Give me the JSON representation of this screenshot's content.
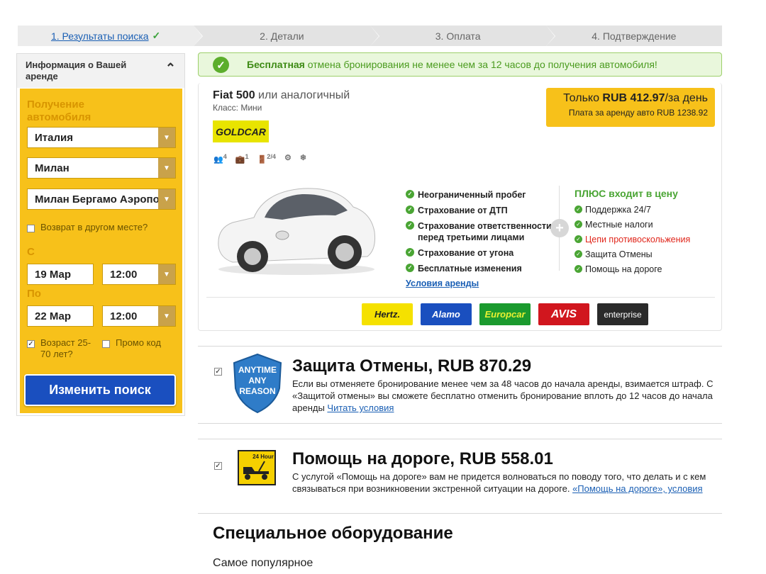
{
  "steps": [
    {
      "label": "1. Результаты поиска"
    },
    {
      "label": "2. Детали"
    },
    {
      "label": "3. Оплата"
    },
    {
      "label": "4. Подтверждение"
    }
  ],
  "sidebar": {
    "header": "Информация о Вашей аренде",
    "pickup_label": "Получение автомобиля",
    "country": "Италия",
    "city": "Милан",
    "location": "Милан Бергамо Аэропорт",
    "return_other": "Возврат в другом месте?",
    "from_label": "С",
    "from_date": "19 Мар",
    "from_time": "12:00",
    "to_label": "По",
    "to_date": "22 Мар",
    "to_time": "12:00",
    "age_label": "Возраст 25-70 лет?",
    "promo_label": "Промо код",
    "search_button": "Изменить поиск"
  },
  "banner": {
    "bold": "Бесплатная",
    "text": " отмена бронирования не менее чем за 12 часов до получения автомобиля!"
  },
  "car": {
    "name": "Fiat 500",
    "similar": " или аналогичный",
    "class": "Класс: Мини",
    "supplier_logo": "GOLDCAR",
    "seats": "4",
    "bags": "1",
    "doors": "2/4",
    "price_prefix": "Только ",
    "price_value": "RUB 412.97",
    "price_suffix": "/за день",
    "price_total": "Плата за аренду авто RUB 1238.92",
    "features": [
      "Неограниченный пробег",
      "Страхование от ДТП",
      "Страхование ответственности перед третьими лицами",
      "Страхование от угона",
      "Бесплатные изменения"
    ],
    "terms_link": "Условия аренды",
    "plus_title": "ПЛЮС входит в цену",
    "plus_items": [
      "Поддержка 24/7",
      "Местные налоги",
      "Цепи противоскольжения",
      "Защита Отмены",
      "Помощь на дороге"
    ],
    "brands": [
      "Hertz.",
      "Alamo",
      "Europcar",
      "AVIS",
      "enterprise"
    ]
  },
  "protection": {
    "badge": "ANYTIME ANY REASON",
    "title": "Защита Отмены, RUB 870.29",
    "text": "Если вы отменяете бронирование менее чем за 48 часов до начала аренды, взимается штраф. С «Защитой отмены» вы сможете бесплатно отменить бронирование вплоть до 12 часов до начала аренды ",
    "link": "Читать условия"
  },
  "roadside": {
    "badge": "24 Hour",
    "title": "Помощь на дороге, RUB 558.01",
    "text": "С услугой «Помощь на дороге» вам не придется волноваться по поводу того, что делать и с кем связываться при возникновении экстренной ситуации на дороге. ",
    "link1": "«Помощь на дороге», условия"
  },
  "equipment": {
    "title": "Специальное оборудование",
    "subtitle": "Самое популярное"
  },
  "colors": {
    "accent": "#f7c11a",
    "button": "#1a4fbf",
    "success": "#4aa534",
    "link": "#1a5fb4"
  }
}
